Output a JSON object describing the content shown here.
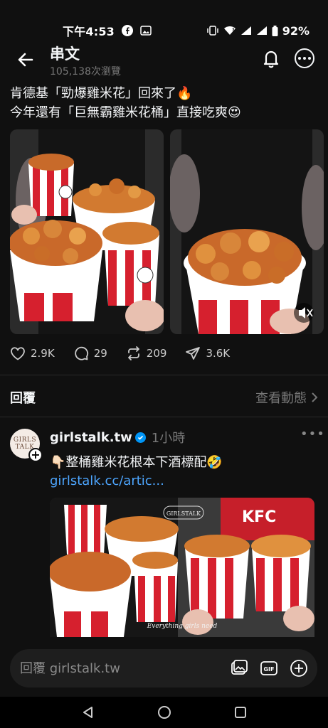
{
  "status_bar": {
    "time": "下午4:53",
    "battery": "92%"
  },
  "header": {
    "title": "串文",
    "views": "105,138次瀏覽"
  },
  "post": {
    "line1": "肯德基「勁爆雞米花」回來了",
    "line1_emoji": "🔥",
    "line2": "今年還有「巨無霸雞米花桶」直接吃爽",
    "line2_emoji": "😍",
    "stats": {
      "likes": "2.9K",
      "comments": "29",
      "reposts": "209",
      "shares": "3.6K"
    }
  },
  "replies": {
    "title": "回覆",
    "activity_link": "查看動態"
  },
  "reply": {
    "avatar_text_1": "GIRLS",
    "avatar_text_2": "TALK",
    "username": "girlstalk.tw",
    "time": "1小時",
    "text_emoji_prefix": "👇🏻",
    "text": "整桶雞米花根本下酒標配",
    "text_emoji_suffix": "🤣",
    "link": "girlstalk.cc/artic...",
    "image_watermark": "GIRLSTALK",
    "image_caption": "Everything girls need"
  },
  "composer": {
    "placeholder": "回覆 girlstalk.tw"
  },
  "colors": {
    "background": "#101010",
    "link": "#4da6ff",
    "verified": "#0095f6",
    "kfc_red": "#d6202e"
  }
}
